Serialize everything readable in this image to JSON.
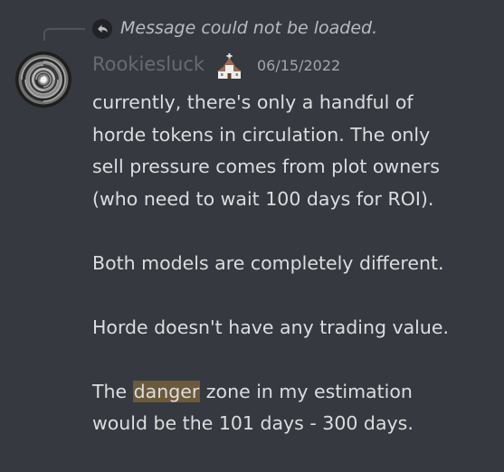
{
  "reply": {
    "icon": "reply-arrow-icon",
    "text": "Message could not be loaded."
  },
  "author": {
    "avatar_icon": "spiral-avatar-icon",
    "username": "Rookiesluck",
    "role_icon": "church-icon",
    "timestamp": "06/15/2022"
  },
  "content": {
    "p1": {
      "l1": "currently, there's only a handful of",
      "l2": "horde tokens in circulation. The only",
      "l3": "sell pressure comes from plot owners",
      "l4": "(who need to wait 100 days for ROI)."
    },
    "p2": {
      "l1": "Both models are completely different."
    },
    "p3": {
      "l1": "Horde doesn't have any trading value."
    },
    "p4": {
      "l1_before": "The ",
      "l1_highlight": "danger",
      "l1_after": " zone in my estimation",
      "l2": "would be the 101 days - 300 days."
    }
  },
  "colors": {
    "background": "#36393f",
    "text": "#dcddde",
    "username": "#686b6f",
    "timestamp": "#a3a6aa",
    "highlight": "#6b5a3c"
  }
}
